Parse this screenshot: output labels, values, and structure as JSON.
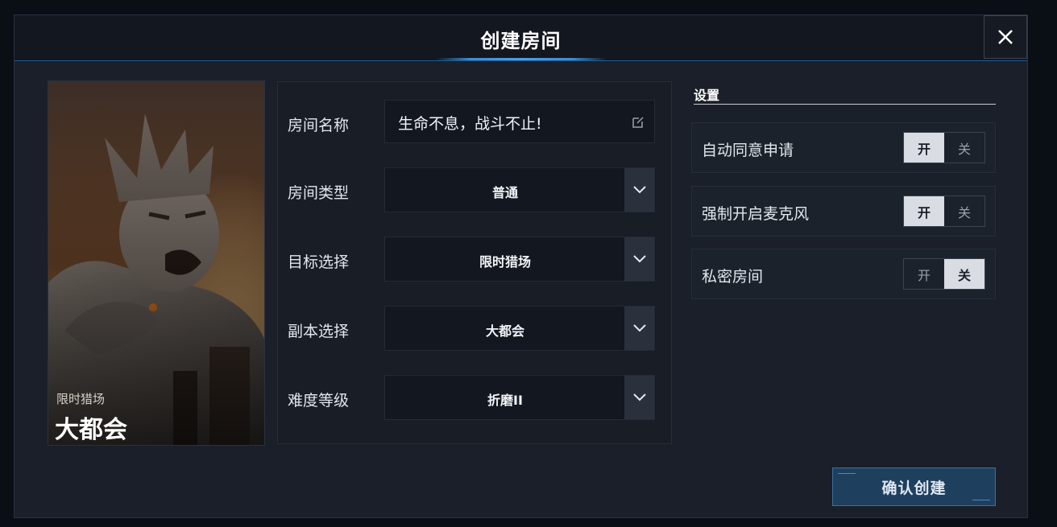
{
  "dialog": {
    "title": "创建房间",
    "close_icon": "close-icon"
  },
  "poster": {
    "subtitle": "限时猎场",
    "title": "大都会"
  },
  "form": {
    "rows": [
      {
        "label": "房间名称",
        "value": "生命不息，战斗不止!",
        "kind": "text",
        "icon": "edit-icon"
      },
      {
        "label": "房间类型",
        "value": "普通",
        "kind": "select",
        "icon": "chevron-down-icon"
      },
      {
        "label": "目标选择",
        "value": "限时猎场",
        "kind": "select",
        "icon": "chevron-down-icon"
      },
      {
        "label": "副本选择",
        "value": "大都会",
        "kind": "select",
        "icon": "chevron-down-icon"
      },
      {
        "label": "难度等级",
        "value": "折磨II",
        "kind": "select",
        "icon": "chevron-down-icon"
      }
    ]
  },
  "settings": {
    "title": "设置",
    "on_label": "开",
    "off_label": "关",
    "items": [
      {
        "label": "自动同意申请",
        "state": "on"
      },
      {
        "label": "强制开启麦克风",
        "state": "on"
      },
      {
        "label": "私密房间",
        "state": "off"
      }
    ]
  },
  "confirm": {
    "label": "确认创建"
  },
  "colors": {
    "accent_blue": "#3a8cd2",
    "toggle_active": "#d9dde3",
    "panel": "#1a1f29"
  }
}
